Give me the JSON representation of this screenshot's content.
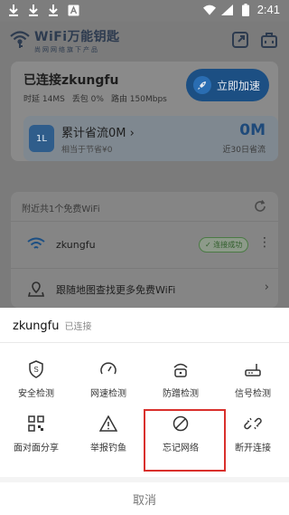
{
  "status_bar": {
    "time": "2:41",
    "left_icons": [
      "download-icon",
      "download-icon",
      "download-icon",
      "a-box-icon"
    ],
    "right_icons": [
      "wifi-signal-icon",
      "cell-signal-icon",
      "battery-icon"
    ]
  },
  "app": {
    "title": "WiFi万能钥匙",
    "subtitle": "尚网网络旗下产品",
    "header_icons": [
      "share-screen-icon",
      "toolbox-icon"
    ]
  },
  "connection": {
    "title": "已连接zkungfu",
    "stats": [
      "时延 14MS",
      "丢包 0%",
      "路由 150Mbps"
    ],
    "speed_button": "立即加速"
  },
  "traffic": {
    "icon_text": "1L",
    "title": "累计省流0M ›",
    "subtitle": "相当于节省¥0",
    "value": "0M",
    "desc": "近30日省流"
  },
  "nearby": {
    "text": "附近共1个免费WiFi",
    "network": {
      "ssid": "zkungfu",
      "badge": "✓ 连接成功"
    },
    "map_text": "跟随地图查找更多免费WiFi"
  },
  "sheet": {
    "ssid": "zkungfu",
    "state": "已连接",
    "actions": [
      {
        "label": "安全检测",
        "icon": "shield-icon"
      },
      {
        "label": "网速检测",
        "icon": "speedometer-icon"
      },
      {
        "label": "防蹭检测",
        "icon": "lock-router-icon"
      },
      {
        "label": "信号检测",
        "icon": "router-icon"
      },
      {
        "label": "面对面分享",
        "icon": "qrcode-icon"
      },
      {
        "label": "举报钓鱼",
        "icon": "warning-icon"
      },
      {
        "label": "忘记网络",
        "icon": "forbidden-icon"
      },
      {
        "label": "断开连接",
        "icon": "broken-link-icon"
      }
    ],
    "cancel": "取消"
  },
  "colors": {
    "accent": "#1c4f83",
    "highlight": "#d9302c",
    "success": "#4b7a45"
  }
}
